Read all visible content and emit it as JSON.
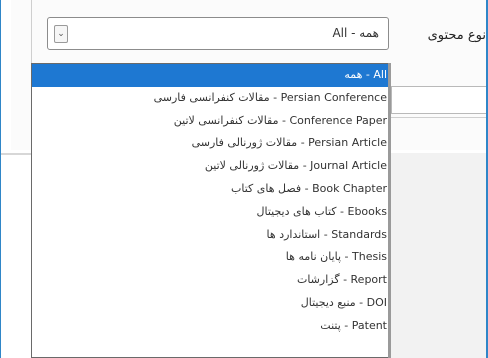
{
  "content_type_field": {
    "label": "نوع محتوی",
    "selected_value": "All - همه",
    "arrow_icon": "chevron-down-icon"
  },
  "dropdown": {
    "options": [
      "All - همه",
      "Persian Conference - مقالات کنفرانسی فارسی",
      "Conference Paper - مقالات کنفرانسی لاتین",
      "Persian Article - مقالات ژورنالی فارسی",
      "Journal Article - مقالات ژورنالی لاتین",
      "Book Chapter - فصل های کتاب",
      "Ebooks - کتاب های دیجیتال",
      "Standards - استاندارد ها",
      "Thesis - پایان نامه ها",
      "Report - گزارشات",
      "DOI - منبع دیجیتال",
      "Patent - پتنت"
    ],
    "selected_index": 0
  },
  "colors": {
    "frame_border": "#2f86c8",
    "selection_highlight": "#1e78d2",
    "content_background": "#f2f2f2"
  }
}
